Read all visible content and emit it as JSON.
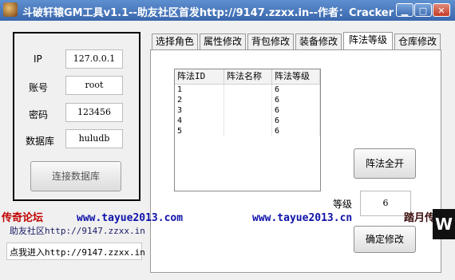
{
  "window": {
    "title": "斗破轩辕GM工具v1.1--助友社区首发http://9147.zzxx.in--作者：Cracker",
    "buttons": {
      "minimize": "▁",
      "maximize": "□",
      "close": "✕"
    }
  },
  "login": {
    "ip_label": "IP",
    "ip_value": "127.0.0.1",
    "account_label": "账号",
    "account_value": "root",
    "password_label": "密码",
    "password_value": "123456",
    "database_label": "数据库",
    "database_value": "huludb",
    "connect_button": "连接数据库"
  },
  "tabs": [
    "选择角色",
    "属性修改",
    "背包修改",
    "装备修改",
    "阵法等级",
    "仓库修改"
  ],
  "formation_table": {
    "columns": [
      "阵法ID",
      "阵法名称",
      "阵法等级"
    ],
    "rows": [
      [
        "1",
        "",
        "6"
      ],
      [
        "2",
        "",
        "6"
      ],
      [
        "3",
        "",
        "6"
      ],
      [
        "4",
        "",
        "6"
      ],
      [
        "5",
        "",
        "6"
      ]
    ]
  },
  "controls": {
    "all_formations_button": "阵法全开",
    "level_label": "等级",
    "level_value": "6",
    "confirm_button": "确定修改"
  },
  "banner": {
    "left_text": "传奇论坛",
    "url_1": "www.tayue2013.com",
    "url_2": "www.tayue2013.cn",
    "right_text": "踏月传奇"
  },
  "links": {
    "community": "助友社区http://9147.zzxx.in",
    "enter": "点我进入http://9147.zzxx.in"
  }
}
